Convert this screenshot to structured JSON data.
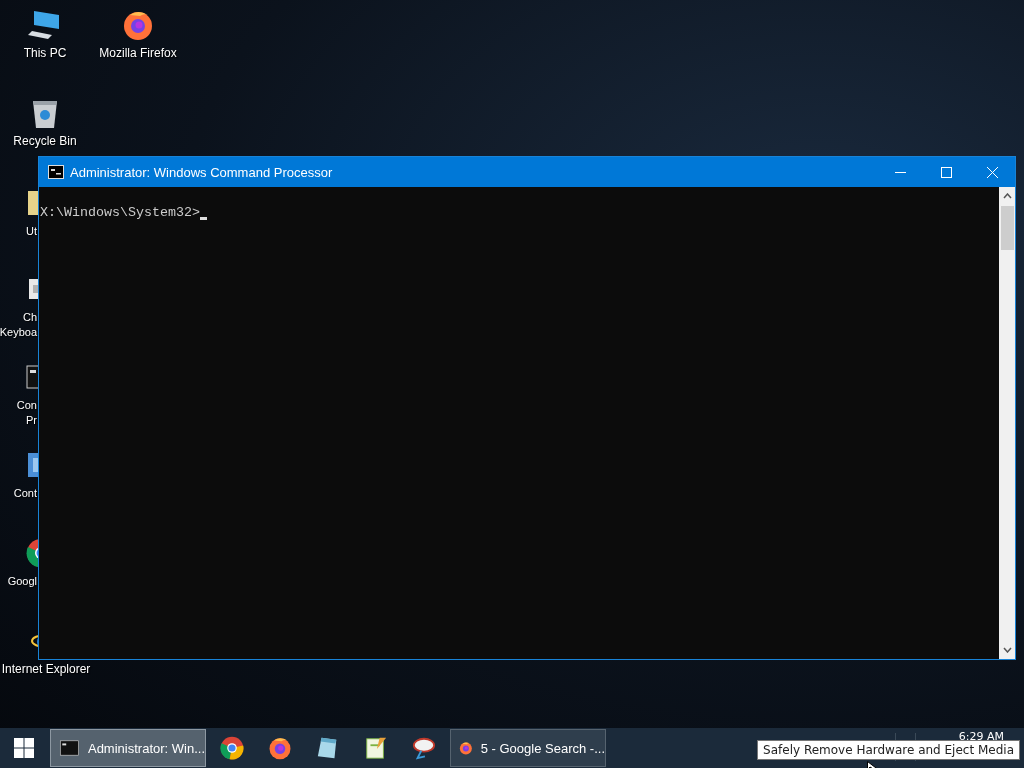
{
  "desktop_icons": [
    {
      "kind": "computer",
      "label_lines": [
        "This PC"
      ]
    },
    {
      "kind": "firefox",
      "label_lines": [
        "Mozilla Firefox"
      ]
    },
    {
      "kind": "recycle-bin",
      "label_lines": [
        "Recycle Bin"
      ]
    },
    {
      "kind": "folder",
      "label_lines": [
        "Ut"
      ]
    },
    {
      "kind": "keyboard",
      "label_lines": [
        "Ch",
        "Keyboa"
      ]
    },
    {
      "kind": "console",
      "label_lines": [
        "Con",
        "Pr"
      ]
    },
    {
      "kind": "control-panel",
      "label_lines": [
        "Cont"
      ]
    },
    {
      "kind": "chrome",
      "label_lines": [
        "Googl"
      ]
    },
    {
      "kind": "explorer",
      "label_lines": [
        "Internet Explorer"
      ]
    }
  ],
  "window": {
    "title": "Administrator: Windows Command Processor",
    "console_lines": [
      "X:\\Windows\\System32>"
    ]
  },
  "taskbar": {
    "items": [
      {
        "kind": "window",
        "label": "Administrator: Win...",
        "selected": true
      },
      {
        "kind": "pinned"
      },
      {
        "kind": "pinned"
      },
      {
        "kind": "pinned"
      },
      {
        "kind": "pinned"
      },
      {
        "kind": "pinned"
      },
      {
        "kind": "window",
        "label": "5 - Google Search -...",
        "selected": false
      }
    ],
    "clock": "6:29 AM"
  },
  "tooltip": "Safely Remove Hardware and Eject Media"
}
